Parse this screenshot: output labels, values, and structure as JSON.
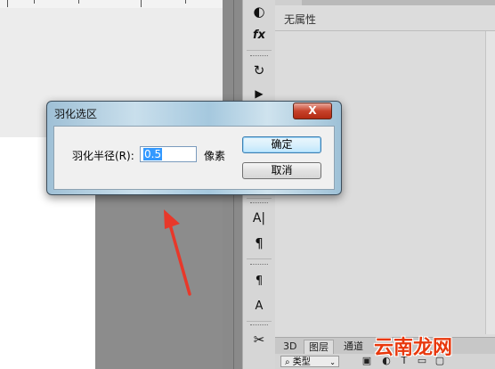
{
  "dialog": {
    "title": "羽化选区",
    "close_symbol": "X",
    "radius_label": "羽化半径(R):",
    "radius_value": "0.5",
    "unit": "像素",
    "ok_label": "确定",
    "cancel_label": "取消"
  },
  "properties_panel": {
    "no_properties": "无属性"
  },
  "bottom_tabs": [
    "3D",
    "图层",
    "通道"
  ],
  "filter": {
    "kind_label": "类型"
  },
  "tools": [
    {
      "name": "adjustment-icon",
      "glyph": "◐"
    },
    {
      "name": "fx-icon",
      "glyph": "fx"
    },
    {
      "name": "history-icon",
      "glyph": "↻"
    },
    {
      "name": "play-icon",
      "glyph": "▶"
    },
    {
      "name": "character-icon",
      "glyph": "A|"
    },
    {
      "name": "paragraph-icon",
      "glyph": "¶"
    },
    {
      "name": "paragraph-style-icon",
      "glyph": "¶"
    },
    {
      "name": "character-style-icon",
      "glyph": "A"
    },
    {
      "name": "tool-preset-icon",
      "glyph": "✂"
    }
  ],
  "watermark": "云南龙网",
  "colors": {
    "arrow": "#e8382a",
    "watermark": "#e8380d",
    "close_button": "#c7422b"
  }
}
